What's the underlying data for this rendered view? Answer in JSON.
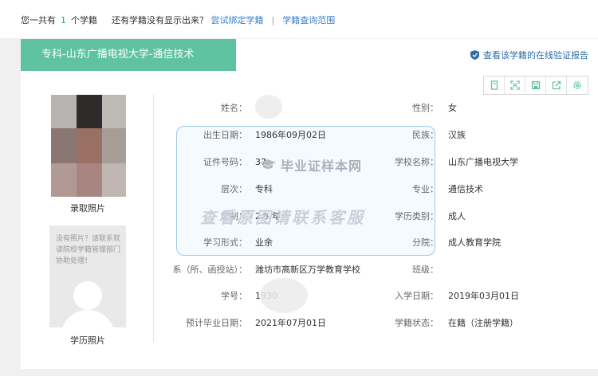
{
  "topbar": {
    "prefix": "您一共有",
    "count": "1",
    "suffix": "个学籍",
    "question": "还有学籍没有显示出来？",
    "bind_link": "尝试绑定学籍",
    "separator": "|",
    "scope_link": "学籍查询范围"
  },
  "card": {
    "title": "专科-山东广播电视大学-通信技术",
    "verify_link": "查看该学籍的在线验证报告",
    "tools": [
      {
        "icon": "document-icon"
      },
      {
        "icon": "fullscreen-icon"
      },
      {
        "icon": "save-icon"
      },
      {
        "icon": "share-icon"
      },
      {
        "icon": "gear-icon"
      }
    ]
  },
  "photos": {
    "admission_caption": "录取照片",
    "no_photo_msg": "没有照片？请联系就读院校学籍管理部门协助处理！",
    "degree_caption": "学历照片"
  },
  "fields": {
    "name_label": "姓名：",
    "name_value": "",
    "gender_label": "性别：",
    "gender_value": "女",
    "birth_label": "出生日期：",
    "birth_value": "1986年09月02日",
    "ethnic_label": "民族：",
    "ethnic_value": "汉族",
    "id_label": "证件号码：",
    "id_value": "37",
    "school_label": "学校名称：",
    "school_value": "山东广播电视大学",
    "level_label": "层次：",
    "level_value": "专科",
    "major_label": "专业：",
    "major_value": "通信技术",
    "duration_label": "学制：",
    "duration_value": "2.5 年",
    "category_label": "学历类别：",
    "category_value": "成人",
    "form_label": "学习形式：",
    "form_value": "业余",
    "branch_label": "分院：",
    "branch_value": "成人教育学院",
    "dept_label": "系（所、函授站）：",
    "dept_value": "潍坊市高新区万学教育学校",
    "class_label": "班级：",
    "class_value": "",
    "student_no_label": "学号：",
    "student_no_value": "1930",
    "enroll_label": "入学日期：",
    "enroll_value": "2019年03月01日",
    "grad_label": "预计毕业日期：",
    "grad_value": "2021年07月01日",
    "status_label": "学籍状态：",
    "status_value": "在籍（注册学籍）"
  },
  "watermark": {
    "logo_text": "毕业证样本网",
    "contact_text": "查看原图请联系客服"
  },
  "colors": {
    "accent_green": "#5fc2a0",
    "link_blue": "#3b7fc4",
    "count_green": "#1fa67a"
  }
}
